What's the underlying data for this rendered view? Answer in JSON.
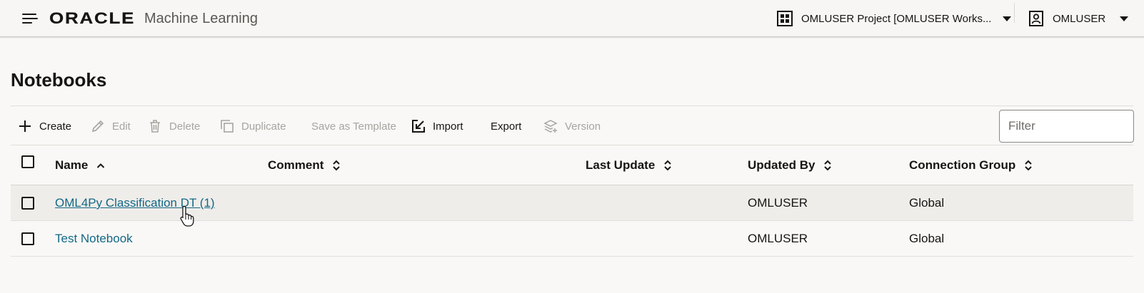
{
  "header": {
    "brand_logo": "ORACLE",
    "brand_app": "Machine Learning",
    "project_selector": "OMLUSER Project [OMLUSER Works...",
    "user_menu": "OMLUSER",
    "icons": {
      "menu": "hamburger-icon",
      "project": "grid-icon",
      "user": "user-badge-icon"
    }
  },
  "page": {
    "title": "Notebooks"
  },
  "toolbar": {
    "create": "Create",
    "edit": "Edit",
    "delete": "Delete",
    "duplicate": "Duplicate",
    "save_as_template": "Save as Template",
    "import": "Import",
    "export": "Export",
    "version": "Version",
    "filter_placeholder": "Filter"
  },
  "table": {
    "columns": [
      "Name",
      "Comment",
      "Last Update",
      "Updated By",
      "Connection Group"
    ],
    "rows": [
      {
        "name": "OML4Py Classification DT (1)",
        "comment": "",
        "last_update": "",
        "updated_by": "OMLUSER",
        "connection_group": "Global"
      },
      {
        "name": "Test Notebook",
        "comment": "",
        "last_update": "",
        "updated_by": "OMLUSER",
        "connection_group": "Global"
      }
    ]
  },
  "colors": {
    "link": "#146886",
    "text": "#161513",
    "disabled": "#a7a4a0",
    "background": "#f9f8f6"
  }
}
